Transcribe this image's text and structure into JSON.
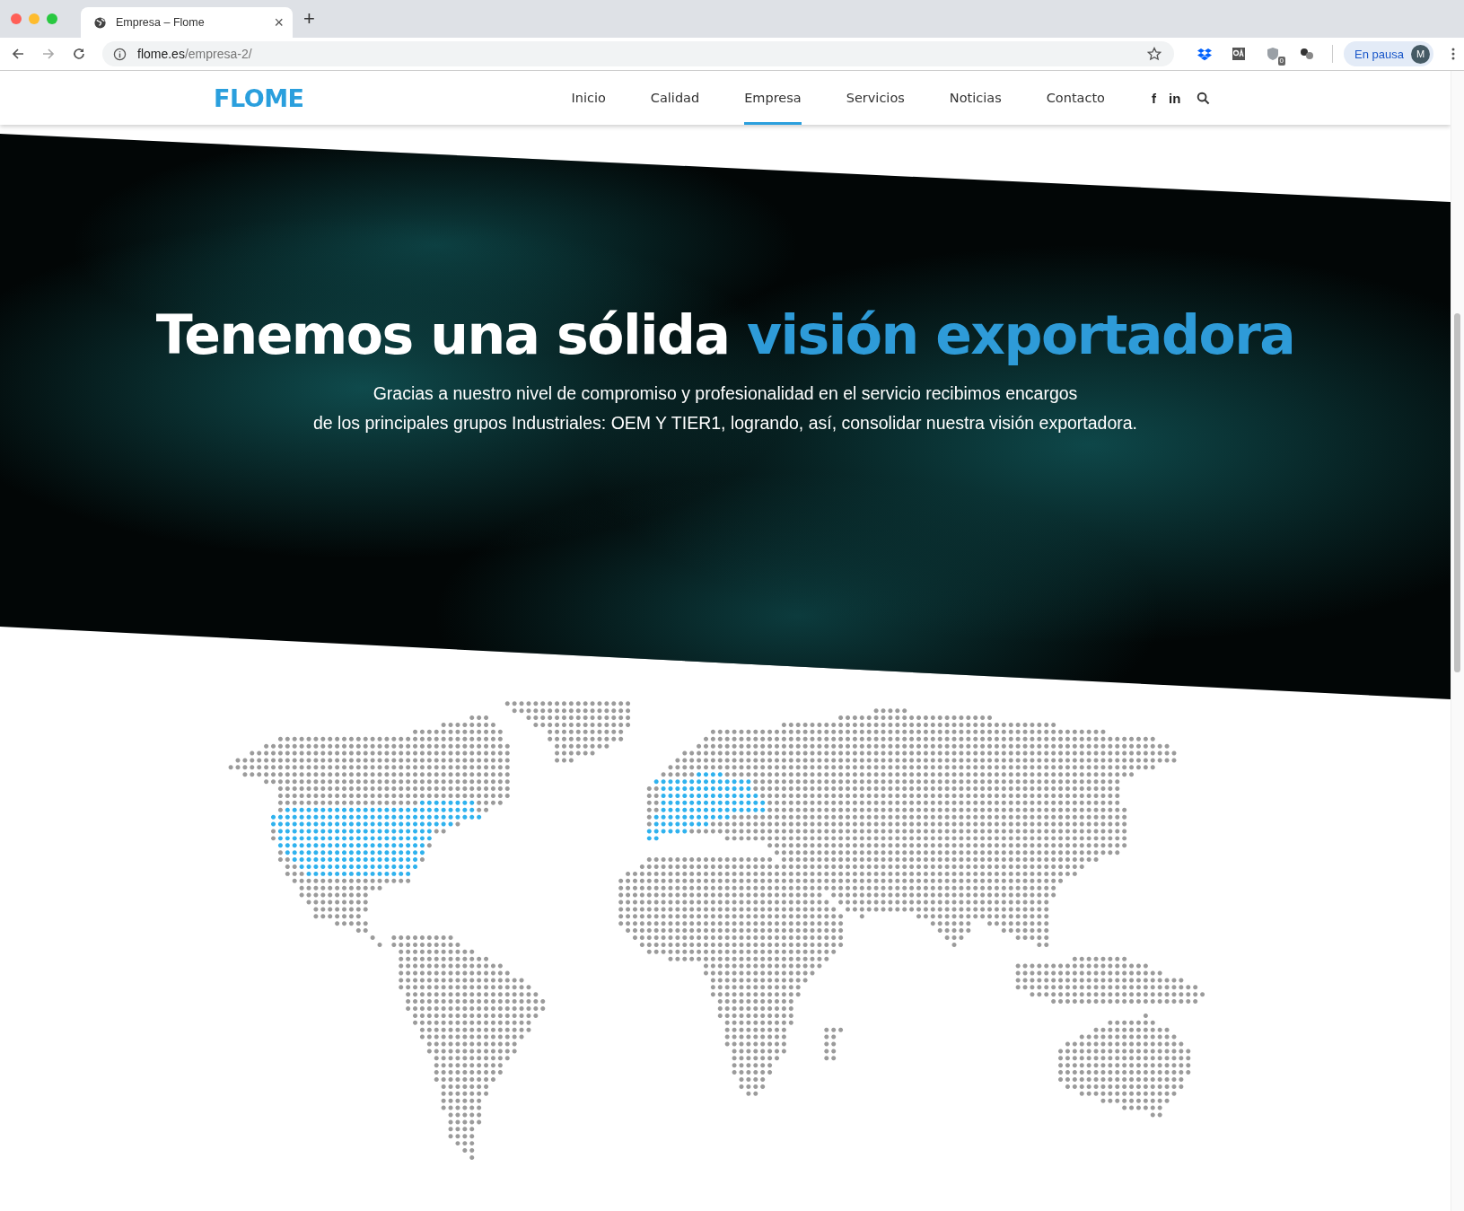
{
  "browser": {
    "tab": {
      "title": "Empresa – Flome",
      "close": "×"
    },
    "new_tab": "+",
    "url": {
      "host": "flome.es",
      "path": "/empresa-2/"
    },
    "extension_badge": "0",
    "profile": {
      "label": "En pausa",
      "initial": "M"
    }
  },
  "site": {
    "logo": "FLOME",
    "nav": [
      {
        "label": "Inicio",
        "selected": false
      },
      {
        "label": "Calidad",
        "selected": false
      },
      {
        "label": "Empresa",
        "selected": true
      },
      {
        "label": "Servicios",
        "selected": false
      },
      {
        "label": "Noticias",
        "selected": false
      },
      {
        "label": "Contacto",
        "selected": false
      }
    ],
    "social": [
      {
        "glyph": "f"
      },
      {
        "glyph": "in"
      }
    ]
  },
  "hero": {
    "headline": [
      {
        "text": "Tenemos una sólida ",
        "highlight": false
      },
      {
        "text": "visión exportadora",
        "highlight": true
      }
    ],
    "lines": [
      "Gracias a nuestro nivel de compromiso y profesionalidad en el servicio recibimos encargos",
      "de los principales grupos Industriales: OEM Y TIER1, logrando, así, consolidar nuestra visión exportadora."
    ]
  }
}
